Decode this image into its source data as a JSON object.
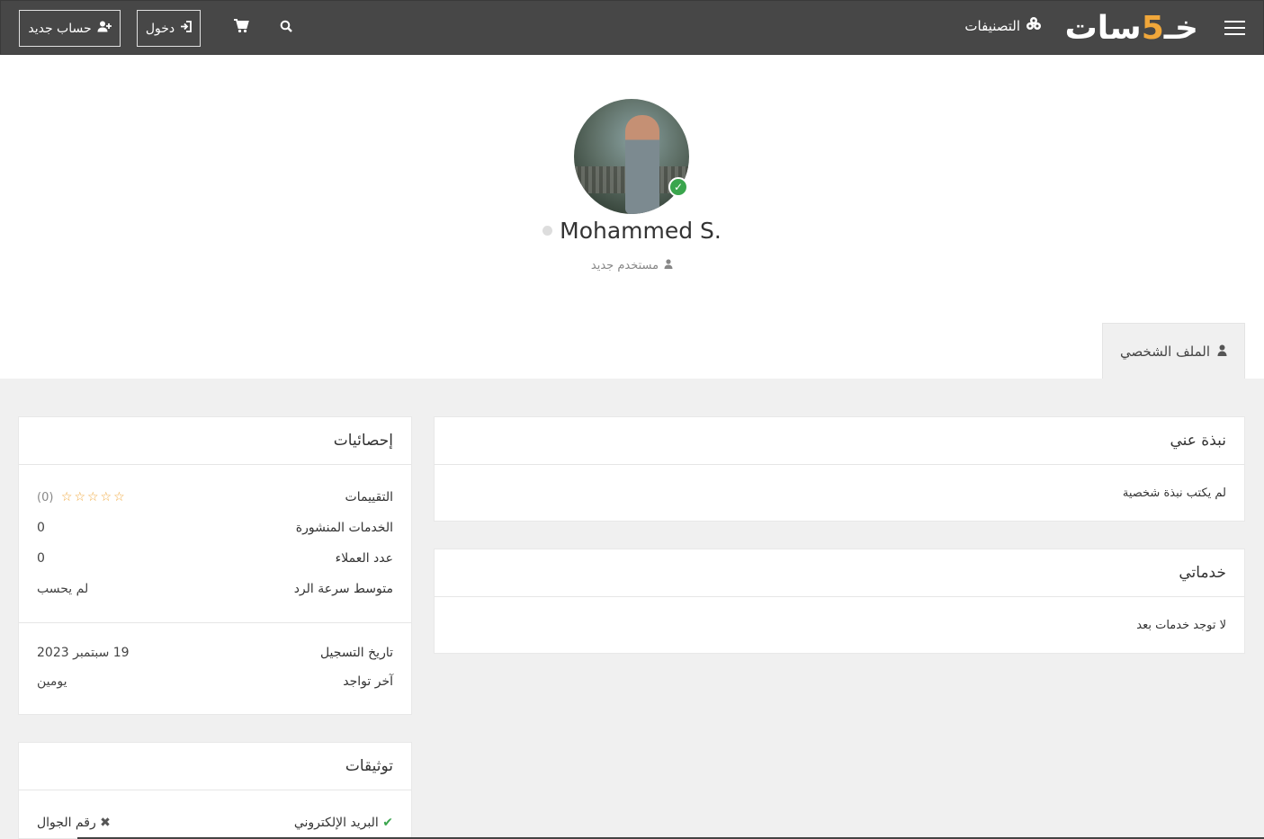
{
  "header": {
    "logo_prefix": "خـ",
    "logo_five": "5",
    "logo_suffix": "سات",
    "categories_label": "التصنيفات",
    "login_label": "دخول",
    "register_label": "حساب جديد"
  },
  "profile": {
    "name": "Mohammed S.",
    "role": "مستخدم جديد",
    "tab_label": "الملف الشخصي"
  },
  "about": {
    "title": "نبذة عني",
    "text": "لم يكتب نبذة شخصية"
  },
  "services": {
    "title": "خدماتي",
    "text": "لا توجد خدمات بعد"
  },
  "stats": {
    "title": "إحصائيات",
    "rows": [
      {
        "label": "التقييمات",
        "value": "(0)"
      },
      {
        "label": "الخدمات المنشورة",
        "value": "0"
      },
      {
        "label": "عدد العملاء",
        "value": "0"
      },
      {
        "label": "متوسط سرعة الرد",
        "value": "لم يحسب"
      }
    ],
    "rating_stars": 0,
    "rows2": [
      {
        "label": "تاريخ التسجيل",
        "value": "19 سبتمبر 2023"
      },
      {
        "label": "آخر تواجد",
        "value": "يومين"
      }
    ]
  },
  "verifications": {
    "title": "توثيقات",
    "email_label": "البريد الإلكتروني",
    "email_verified": true,
    "phone_label": "رقم الجوال",
    "phone_verified": false
  },
  "colors": {
    "topbar": "#474747",
    "accent": "#f0a73a",
    "verified": "#3aa54d"
  }
}
